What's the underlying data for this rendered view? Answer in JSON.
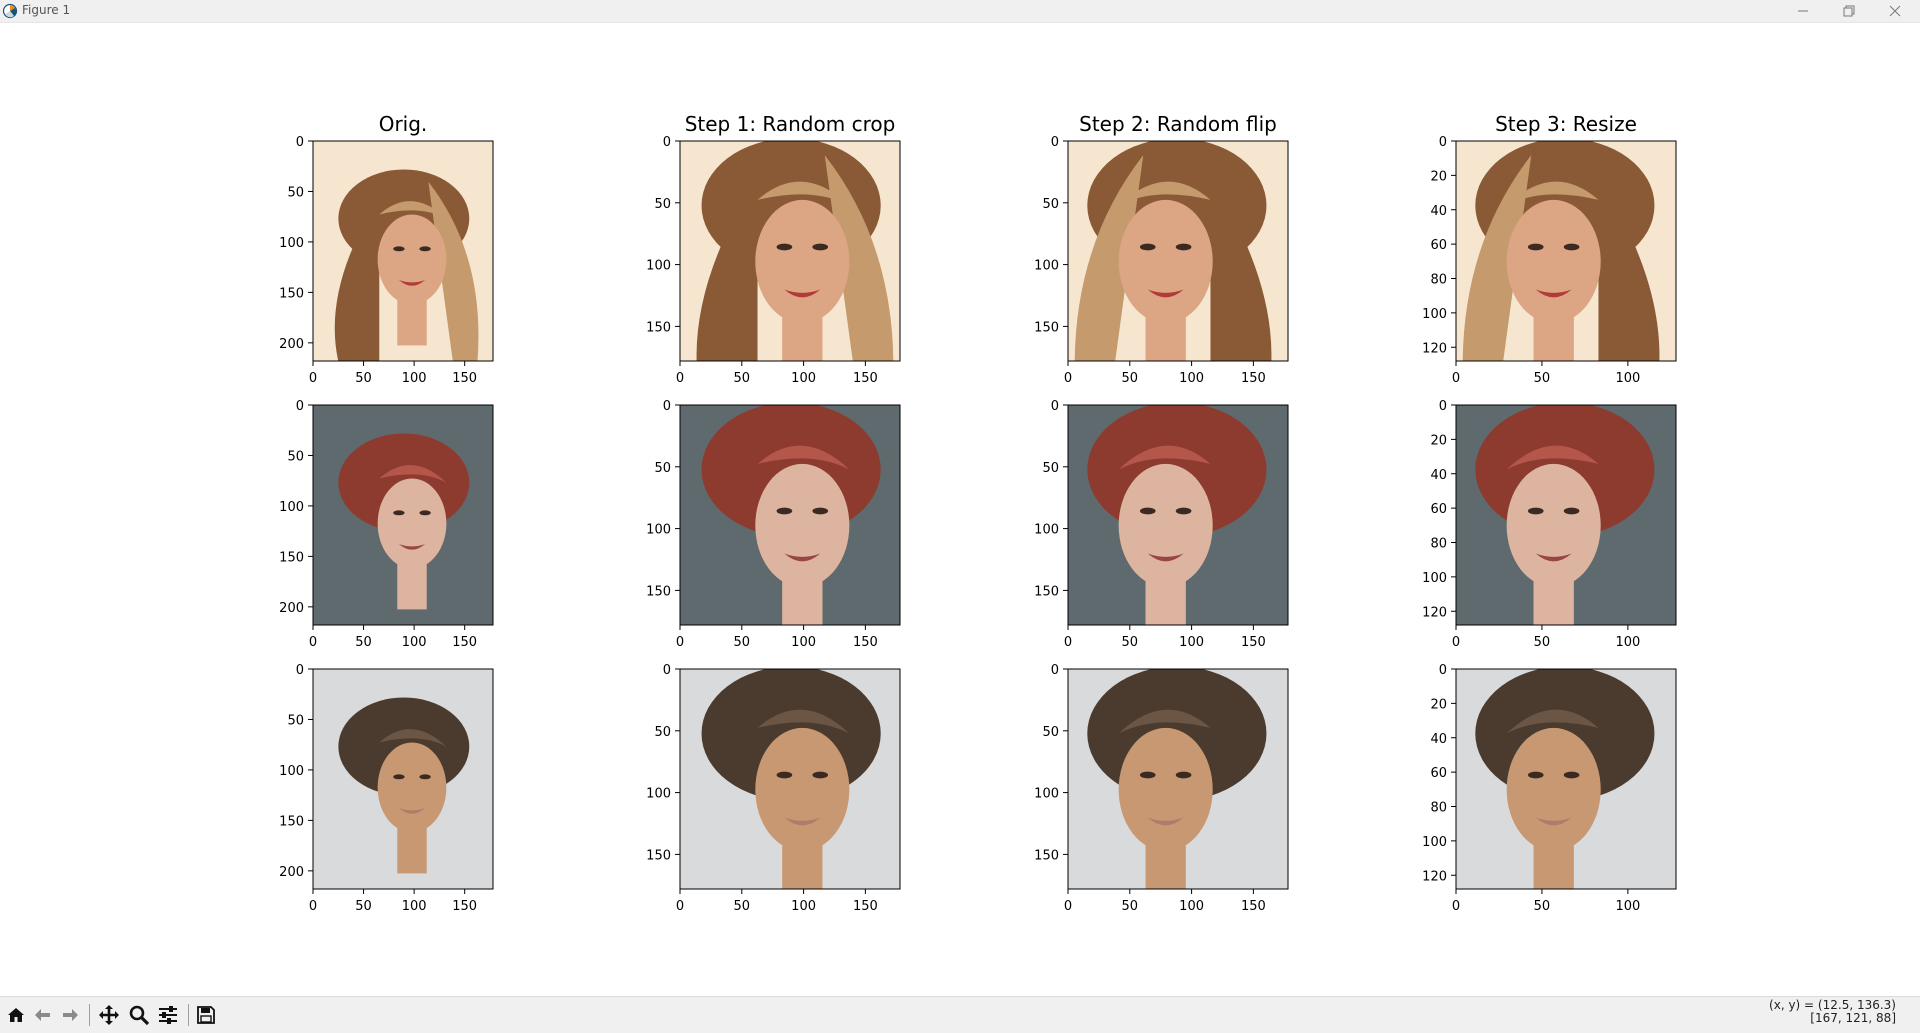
{
  "window": {
    "title": "Figure 1",
    "icons": [
      "matplotlib-icon",
      "minimize-icon",
      "maximize-icon",
      "close-icon"
    ]
  },
  "figure": {
    "columns": [
      {
        "title": "Orig.",
        "xticks": [
          "0",
          "50",
          "100",
          "150"
        ],
        "yticks": [
          "0",
          "50",
          "100",
          "150",
          "200"
        ],
        "xlim": [
          0,
          178
        ],
        "ylim": [
          218,
          0
        ]
      },
      {
        "title": "Step 1: Random crop",
        "xticks": [
          "0",
          "50",
          "100",
          "150"
        ],
        "yticks": [
          "0",
          "50",
          "100",
          "150"
        ],
        "xlim": [
          0,
          178
        ],
        "ylim": [
          178,
          0
        ]
      },
      {
        "title": "Step 2: Random flip",
        "xticks": [
          "0",
          "50",
          "100",
          "150"
        ],
        "yticks": [
          "0",
          "50",
          "100",
          "150"
        ],
        "xlim": [
          0,
          178
        ],
        "ylim": [
          178,
          0
        ]
      },
      {
        "title": "Step 3: Resize",
        "xticks": [
          "0",
          "50",
          "100"
        ],
        "yticks": [
          "0",
          "20",
          "40",
          "60",
          "80",
          "100",
          "120"
        ],
        "xlim": [
          0,
          128
        ],
        "ylim": [
          128,
          0
        ]
      }
    ],
    "rows": [
      {
        "subject": "woman-long-brown-hair",
        "colors": {
          "bg": "#f6e6cf",
          "hair": "#8a5a36",
          "hair_light": "#c59a6c",
          "skin": "#dca583",
          "lips": "#b23a3a"
        }
      },
      {
        "subject": "woman-red-hair",
        "colors": {
          "bg": "#5f6a6e",
          "hair": "#8d3b2e",
          "hair_light": "#b4574a",
          "skin": "#dcb4a0",
          "lips": "#9a4545"
        }
      },
      {
        "subject": "man-dark-hair",
        "colors": {
          "bg": "#d9dadc",
          "hair": "#4a3b2e",
          "hair_light": "#6b5544",
          "skin": "#c89873",
          "lips": "#b07b6a"
        }
      }
    ]
  },
  "toolbar": {
    "buttons": [
      "home-icon",
      "back-icon",
      "forward-icon",
      "pan-icon",
      "zoom-icon",
      "configure-subplots-icon",
      "save-icon"
    ],
    "coords_line1": "(x, y) = (12.5, 136.3)",
    "coords_line2": "[167, 121, 88]"
  }
}
